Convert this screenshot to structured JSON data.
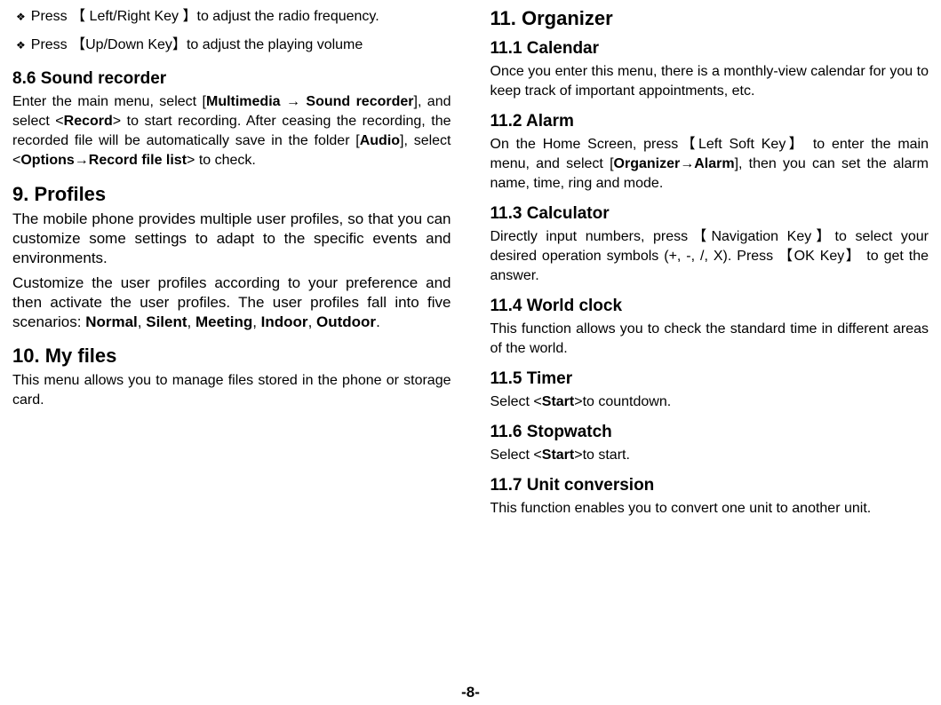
{
  "left": {
    "bullet1_pre": "Press ",
    "bullet1_key": "【 Left/Right Key 】",
    "bullet1_post": "to adjust the radio frequency.",
    "bullet2_pre": "Press ",
    "bullet2_key": "【Up/Down Key】",
    "bullet2_post": "to adjust the playing volume",
    "h86": "8.6 Sound recorder",
    "p86_1": "Enter the main menu, select [",
    "p86_b1": "Multimedia",
    "p86_arrow1": " → ",
    "p86_b2": "Sound recorder",
    "p86_2": "], and select <",
    "p86_b3": "Record",
    "p86_3": "> to start recording. After ceasing the recording, the recorded file will be automatically save in the folder [",
    "p86_b4": "Audio",
    "p86_4": "], select <",
    "p86_b5": "Options→Record file list",
    "p86_5": "> to check.",
    "h9": "9. Profiles",
    "p9a": "The mobile phone provides multiple user profiles, so that you can customize some settings to adapt to the specific events and environments.",
    "p9b_1": "Customize the user profiles according to your preference and then activate the user profiles. The user profiles fall into five scenarios: ",
    "p9b_b1": "Normal",
    "p9b_c1": ", ",
    "p9b_b2": "Silent",
    "p9b_c2": ", ",
    "p9b_b3": "Meeting",
    "p9b_c3": ", ",
    "p9b_b4": "Indoor",
    "p9b_c4": ", ",
    "p9b_b5": "Outdoor",
    "p9b_c5": ".",
    "h10": "10. My files",
    "p10": "This menu allows you to manage files stored in the phone or storage card."
  },
  "right": {
    "h11": "11. Organizer",
    "h111": "11.1 Calendar",
    "p111": "Once you enter this menu, there is a monthly-view calendar for you to keep track of important appointments, etc.",
    "h112": "11.2 Alarm",
    "p112_1": "On the Home Screen, press",
    "p112_key1": "【Left Soft Key】",
    "p112_2": "  to enter the main menu, and select [",
    "p112_b1": "Organizer→Alarm",
    "p112_3": "], then you can set the alarm name, time, ring and mode.",
    "h113": "11.3 Calculator",
    "p113_1": "Directly input numbers, press",
    "p113_key1": "【Navigation Key】",
    "p113_2": "to select your desired operation symbols (+, -, /, X). Press  ",
    "p113_key2": "【OK Key】",
    "p113_3": "  to get the answer.",
    "h114": "11.4 World clock",
    "p114": "This function allows you to check the standard time in different areas of the world.",
    "h115": "11.5 Timer",
    "p115_1": "Select <",
    "p115_b1": "Start",
    "p115_2": ">to countdown.",
    "h116": "11.6 Stopwatch",
    "p116_1": "Select <",
    "p116_b1": "Start",
    "p116_2": ">to start.",
    "h117": "11.7 Unit conversion",
    "p117": "This function enables you to convert one unit to another unit."
  },
  "pageNumber": "-8-"
}
